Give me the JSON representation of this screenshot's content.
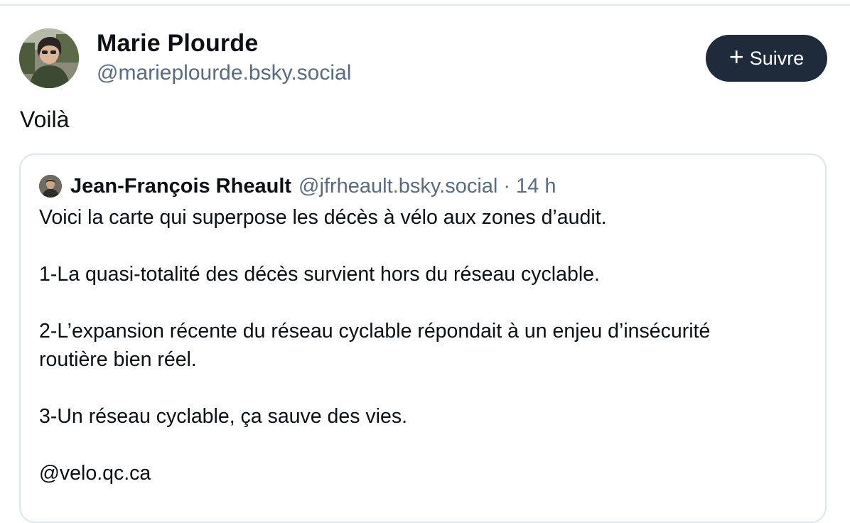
{
  "post": {
    "author": {
      "name": "Marie Plourde",
      "handle": "@marieplourde.bsky.social"
    },
    "follow_label": "Suivre",
    "text": "Voilà"
  },
  "quote": {
    "author_name": "Jean-François Rheault",
    "author_handle": "@jfrheault.bsky.social",
    "separator": "·",
    "time": "14 h",
    "lines": [
      "Voici la carte qui superpose les décès à vélo aux zones d’audit.",
      "",
      "1-La quasi-totalité des décès survient hors du réseau cyclable.",
      "",
      "2-L’expansion récente du réseau cyclable répondait à un enjeu d’insécurité",
      "routière bien réel.",
      "",
      "3-Un réseau cyclable, ça sauve des vies.",
      "",
      "@velo.qc.ca"
    ]
  },
  "colors": {
    "button_bg": "#1f2b3a",
    "handle_text": "#5b6b7e",
    "border": "#dfe5ec"
  }
}
